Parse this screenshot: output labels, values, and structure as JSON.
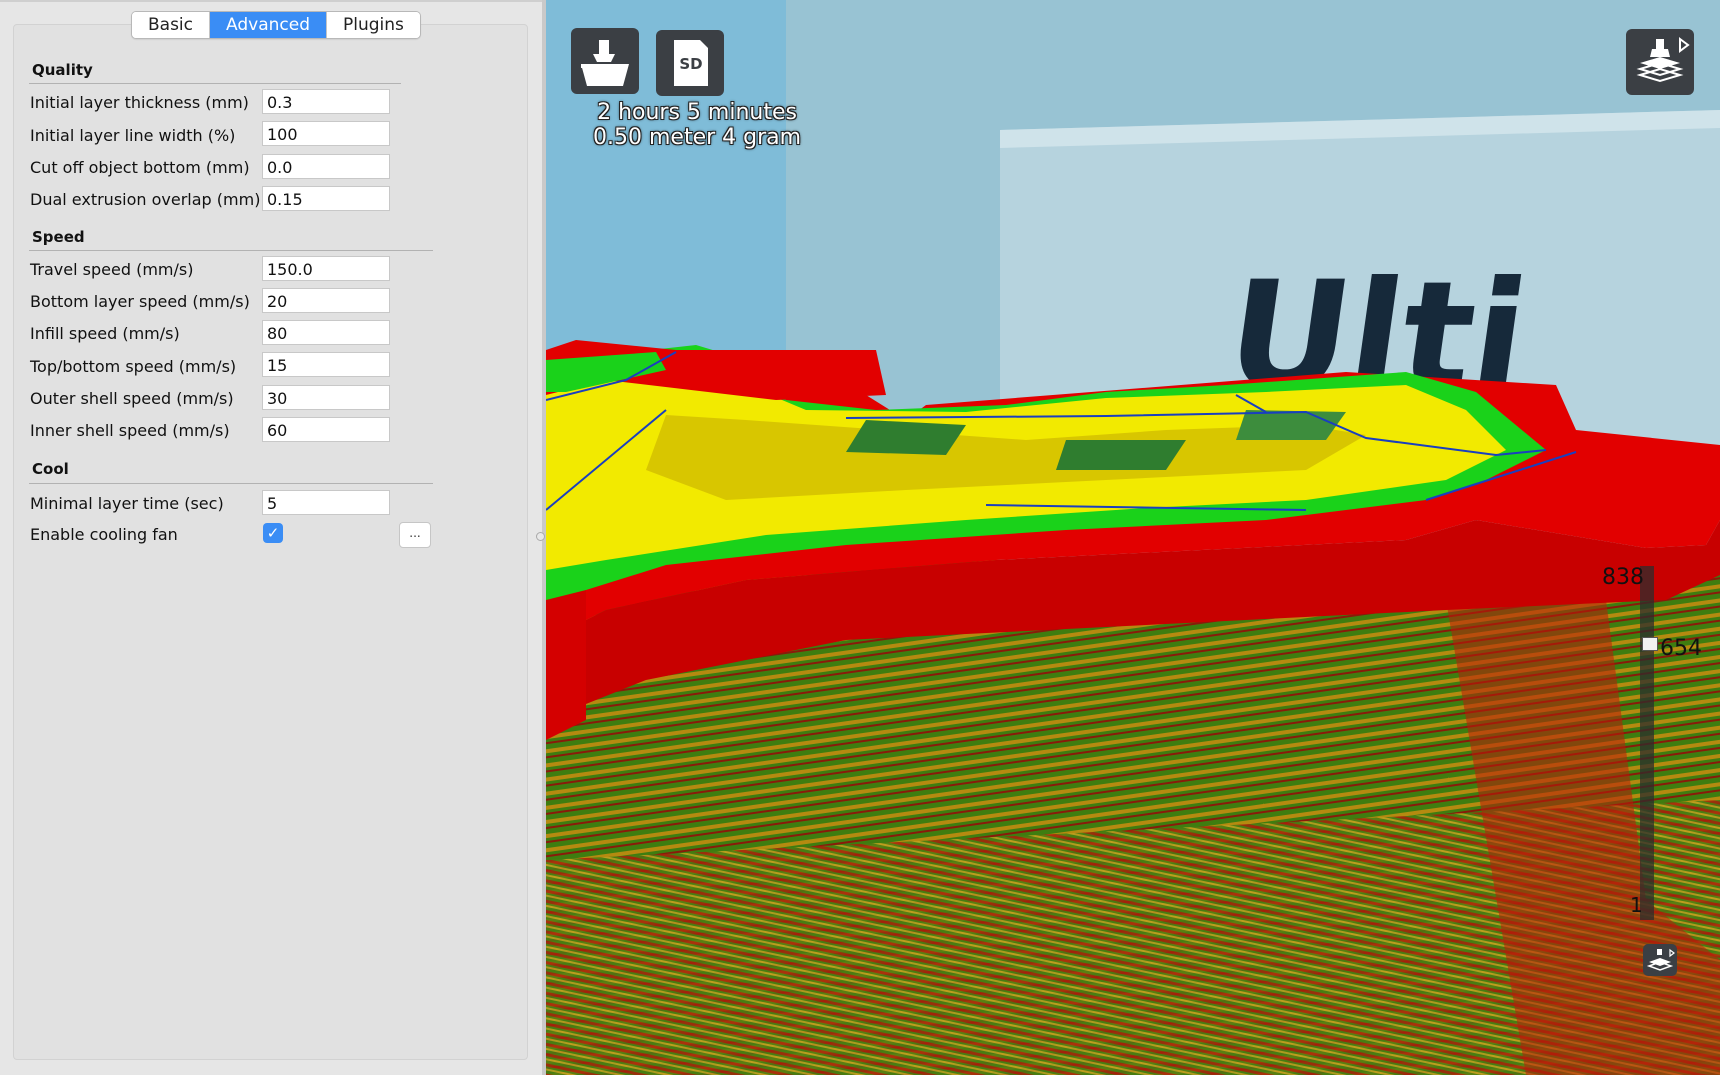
{
  "tabs": [
    {
      "label": "Basic",
      "active": false
    },
    {
      "label": "Advanced",
      "active": true
    },
    {
      "label": "Plugins",
      "active": false
    }
  ],
  "sections": {
    "quality": {
      "title": "Quality",
      "rows": [
        {
          "label": "Initial layer thickness (mm)",
          "value": "0.3"
        },
        {
          "label": "Initial layer line width (%)",
          "value": "100"
        },
        {
          "label": "Cut off object bottom (mm)",
          "value": "0.0"
        },
        {
          "label": "Dual extrusion overlap (mm)",
          "value": "0.15"
        }
      ]
    },
    "speed": {
      "title": "Speed",
      "rows": [
        {
          "label": "Travel speed (mm/s)",
          "value": "150.0"
        },
        {
          "label": "Bottom layer speed (mm/s)",
          "value": "20"
        },
        {
          "label": "Infill speed (mm/s)",
          "value": "80"
        },
        {
          "label": "Top/bottom speed (mm/s)",
          "value": "15"
        },
        {
          "label": "Outer shell speed (mm/s)",
          "value": "30"
        },
        {
          "label": "Inner shell speed (mm/s)",
          "value": "60"
        }
      ]
    },
    "cool": {
      "title": "Cool",
      "rows": [
        {
          "label": "Minimal layer time (sec)",
          "value": "5"
        },
        {
          "label": "Enable cooling fan",
          "checked": true,
          "more_label": "..."
        }
      ]
    }
  },
  "viewport": {
    "print_time": "2 hours 5 minutes",
    "print_material": "0.50 meter 4 gram",
    "sd_label": "SD",
    "brand_text": "Ulti",
    "layer_slider": {
      "max": "838",
      "current": "654",
      "min": "1",
      "current_fraction": 0.78
    },
    "icons": [
      "load-model-icon",
      "save-to-sd-icon",
      "view-mode-icon",
      "layer-view-icon"
    ],
    "colors": {
      "outer_wall": "#e60000",
      "inner_wall": "#00dd00",
      "infill": "#ffee00",
      "travel": "#1a3fbf",
      "background": "#7bbad6"
    }
  }
}
